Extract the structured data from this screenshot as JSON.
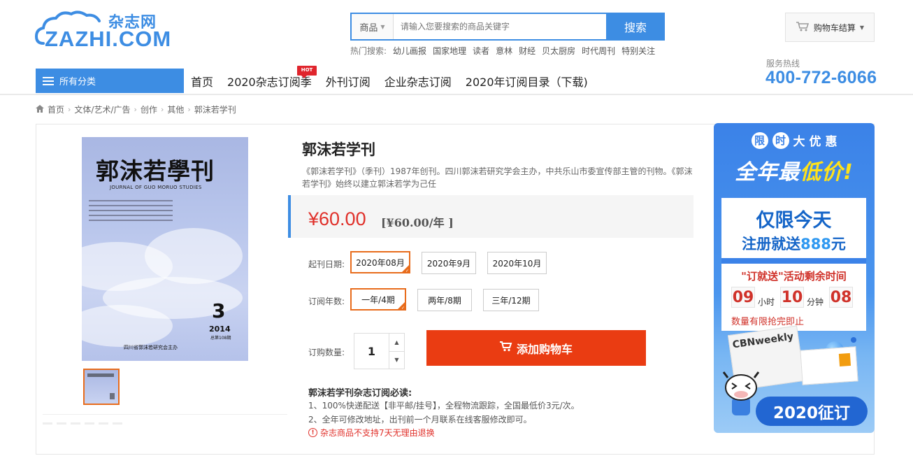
{
  "header": {
    "logo_cn": "杂志网",
    "logo_en": "ZAZHI.COM",
    "search": {
      "category": "商品",
      "placeholder": "请输入您要搜索的商品关键字",
      "button": "搜索"
    },
    "hot_search_label": "热门搜索:",
    "hot_keywords": [
      "幼儿画报",
      "国家地理",
      "读者",
      "意林",
      "财经",
      "贝太厨房",
      "时代周刊",
      "特别关注"
    ],
    "cart_label": "购物车结算",
    "hotline_label": "服务热线",
    "hotline_number": "400-772-6066"
  },
  "nav": {
    "all_categories": "所有分类",
    "items": [
      "首页",
      "2020杂志订阅季",
      "外刊订阅",
      "企业杂志订阅",
      "2020年订阅目录（下载)"
    ],
    "hot_badge": "HOT"
  },
  "breadcrumb": [
    "首页",
    "文体/艺术/广告",
    "创作",
    "其他",
    "郭沫若学刊"
  ],
  "product": {
    "cover": {
      "title": "郭沫若學刊",
      "subtitle_en": "JOURNAL OF GUO MORUO STUDIES",
      "issue": "3",
      "year": "2014",
      "issue_note": "总第108期",
      "publisher": "四川省郭沫若研究会主办"
    },
    "title": "郭沫若学刊",
    "description": "《郭沫若学刊》（季刊）1987年创刊。四川郭沫若研究学会主办，中共乐山市委宣传部主管的刊物。《郭沫若学刊》始终以建立郭沫若学为己任",
    "price": "¥60.00",
    "price_per_year": "[¥60.00/年 ]",
    "start_date_label": "起刊日期:",
    "start_dates": [
      "2020年08月",
      "2020年9月",
      "2020年10月"
    ],
    "selected_start_date": "2020年08月",
    "years_label": "订阅年数:",
    "years": [
      "一年/4期",
      "两年/8期",
      "三年/12期"
    ],
    "selected_years": "一年/4期",
    "quantity_label": "订购数量:",
    "quantity": "1",
    "add_to_cart": "添加购物车",
    "notice_title": "郭沫若学刊杂志订阅必读:",
    "notice_1": "1、100%快递配送【非平邮/挂号】，全程物流跟踪，全国最低价3元/次。",
    "notice_2": "2、全年可修改地址，出刊前一个月联系在线客服修改即可。",
    "notice_3": "杂志商品不支持7天无理由退换"
  },
  "ad": {
    "top_circle_1": "限",
    "top_circle_2": "时",
    "top_plain_1": "大",
    "top_plain_2": "优",
    "top_plain_3": "惠",
    "headline_prefix": "全年最",
    "headline_highlight": "低价!",
    "today": "仅限今天",
    "register_prefix": "注册就送",
    "register_amount": "888",
    "register_suffix": "元",
    "countdown_title": "\"订就送\"活动剩余时间",
    "hours": "09",
    "hours_unit": "小时",
    "minutes": "10",
    "minutes_unit": "分钟",
    "seconds": "08",
    "limited": "数量有限抢完即止",
    "magazine_name": "CBNweekly",
    "bottom": "2020征订"
  }
}
